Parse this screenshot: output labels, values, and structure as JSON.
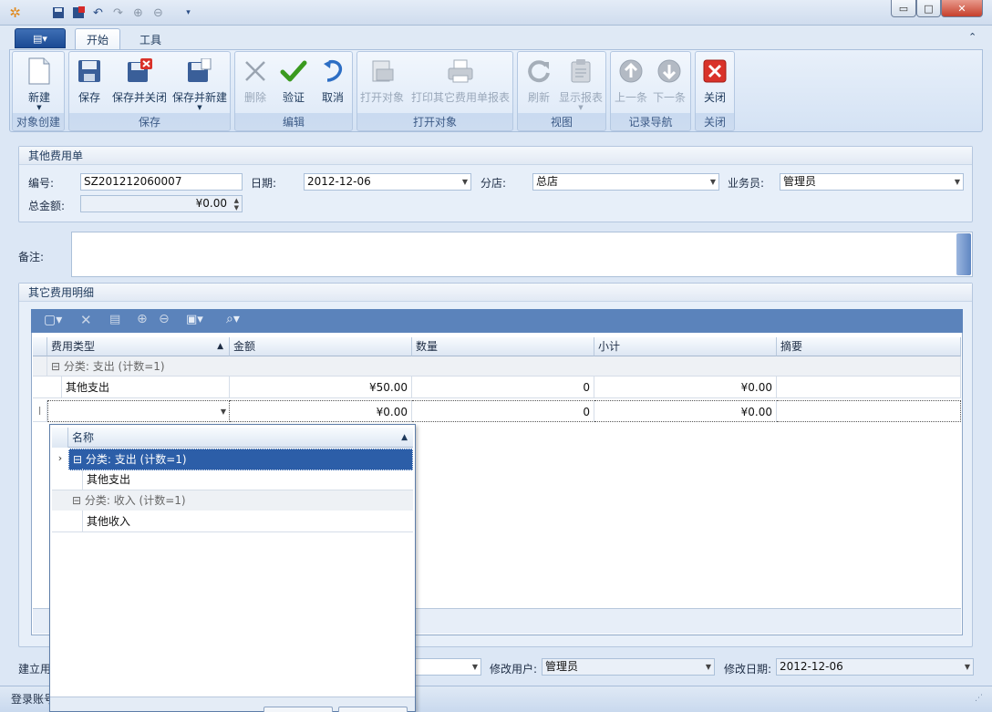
{
  "titlebar": {
    "quick_access": [
      "app-menu-icon",
      "save-icon",
      "save-close-icon",
      "undo-icon",
      "redo-icon",
      "up-icon",
      "down-icon",
      "customize-icon"
    ]
  },
  "ribbon": {
    "app_button": "▤▾",
    "tabs": [
      {
        "label": "开始",
        "active": true
      },
      {
        "label": "工具",
        "active": false
      }
    ],
    "groups": [
      {
        "caption": "对象创建",
        "buttons": [
          {
            "label": "新建",
            "icon": "new-document-icon",
            "enabled": true
          }
        ]
      },
      {
        "caption": "保存",
        "buttons": [
          {
            "label": "保存",
            "icon": "save-icon",
            "enabled": true
          },
          {
            "label": "保存并关闭",
            "icon": "save-close-icon",
            "enabled": true
          },
          {
            "label": "保存并新建",
            "icon": "save-new-icon",
            "enabled": true
          }
        ]
      },
      {
        "caption": "编辑",
        "buttons": [
          {
            "label": "删除",
            "icon": "delete-icon",
            "enabled": false
          },
          {
            "label": "验证",
            "icon": "validate-icon",
            "enabled": true
          },
          {
            "label": "取消",
            "icon": "cancel-icon",
            "enabled": true
          }
        ]
      },
      {
        "caption": "打开对象",
        "buttons": [
          {
            "label": "打开对象",
            "icon": "open-object-icon",
            "enabled": false
          },
          {
            "label": "打印其它费用单报表",
            "icon": "print-icon",
            "enabled": false
          }
        ]
      },
      {
        "caption": "视图",
        "buttons": [
          {
            "label": "刷新",
            "icon": "refresh-icon",
            "enabled": false
          },
          {
            "label": "显示报表",
            "icon": "report-icon",
            "enabled": false
          }
        ]
      },
      {
        "caption": "记录导航",
        "buttons": [
          {
            "label": "上一条",
            "icon": "prev-record-icon",
            "enabled": false
          },
          {
            "label": "下一条",
            "icon": "next-record-icon",
            "enabled": false
          }
        ]
      },
      {
        "caption": "关闭",
        "buttons": [
          {
            "label": "关闭",
            "icon": "close-icon",
            "enabled": true
          }
        ]
      }
    ]
  },
  "form": {
    "section_title": "其他费用单",
    "number_label": "编号:",
    "number_value": "SZ201212060007",
    "date_label": "日期:",
    "date_value": "2012-12-06",
    "branch_label": "分店:",
    "branch_value": "总店",
    "salesman_label": "业务员:",
    "salesman_value": "管理员",
    "total_label": "总金额:",
    "total_value": "¥0.00",
    "remark_label": "备注:",
    "remark_value": ""
  },
  "detail": {
    "section_title": "其它费用明细",
    "columns": [
      "费用类型",
      "金额",
      "数量",
      "小计",
      "摘要"
    ],
    "group_row": "分类: 支出 (计数=1)",
    "rows": [
      {
        "type": "其他支出",
        "amount": "¥50.00",
        "qty": "0",
        "subtotal": "¥0.00",
        "memo": ""
      },
      {
        "type": "",
        "amount": "¥0.00",
        "qty": "0",
        "subtotal": "¥0.00",
        "memo": ""
      }
    ],
    "row_indicator": "I"
  },
  "popup": {
    "column": "名称",
    "rows": [
      {
        "kind": "group",
        "text": "分类: 支出 (计数=1)",
        "selected": true
      },
      {
        "kind": "item",
        "text": "其他支出"
      },
      {
        "kind": "group",
        "text": "分类: 收入 (计数=1)",
        "selected": false
      },
      {
        "kind": "item",
        "text": "其他收入"
      }
    ]
  },
  "footer": {
    "creator_label": "建立用",
    "modifier_label": "修改用户:",
    "modifier_value": "管理员",
    "modify_date_label": "修改日期:",
    "modify_date_value": "2012-12-06"
  },
  "status": {
    "text": "登录账号"
  },
  "colors": {
    "accent": "#5b83bb",
    "selection": "#2c5ea8",
    "ribbon_bg": "#dfe9f5"
  }
}
